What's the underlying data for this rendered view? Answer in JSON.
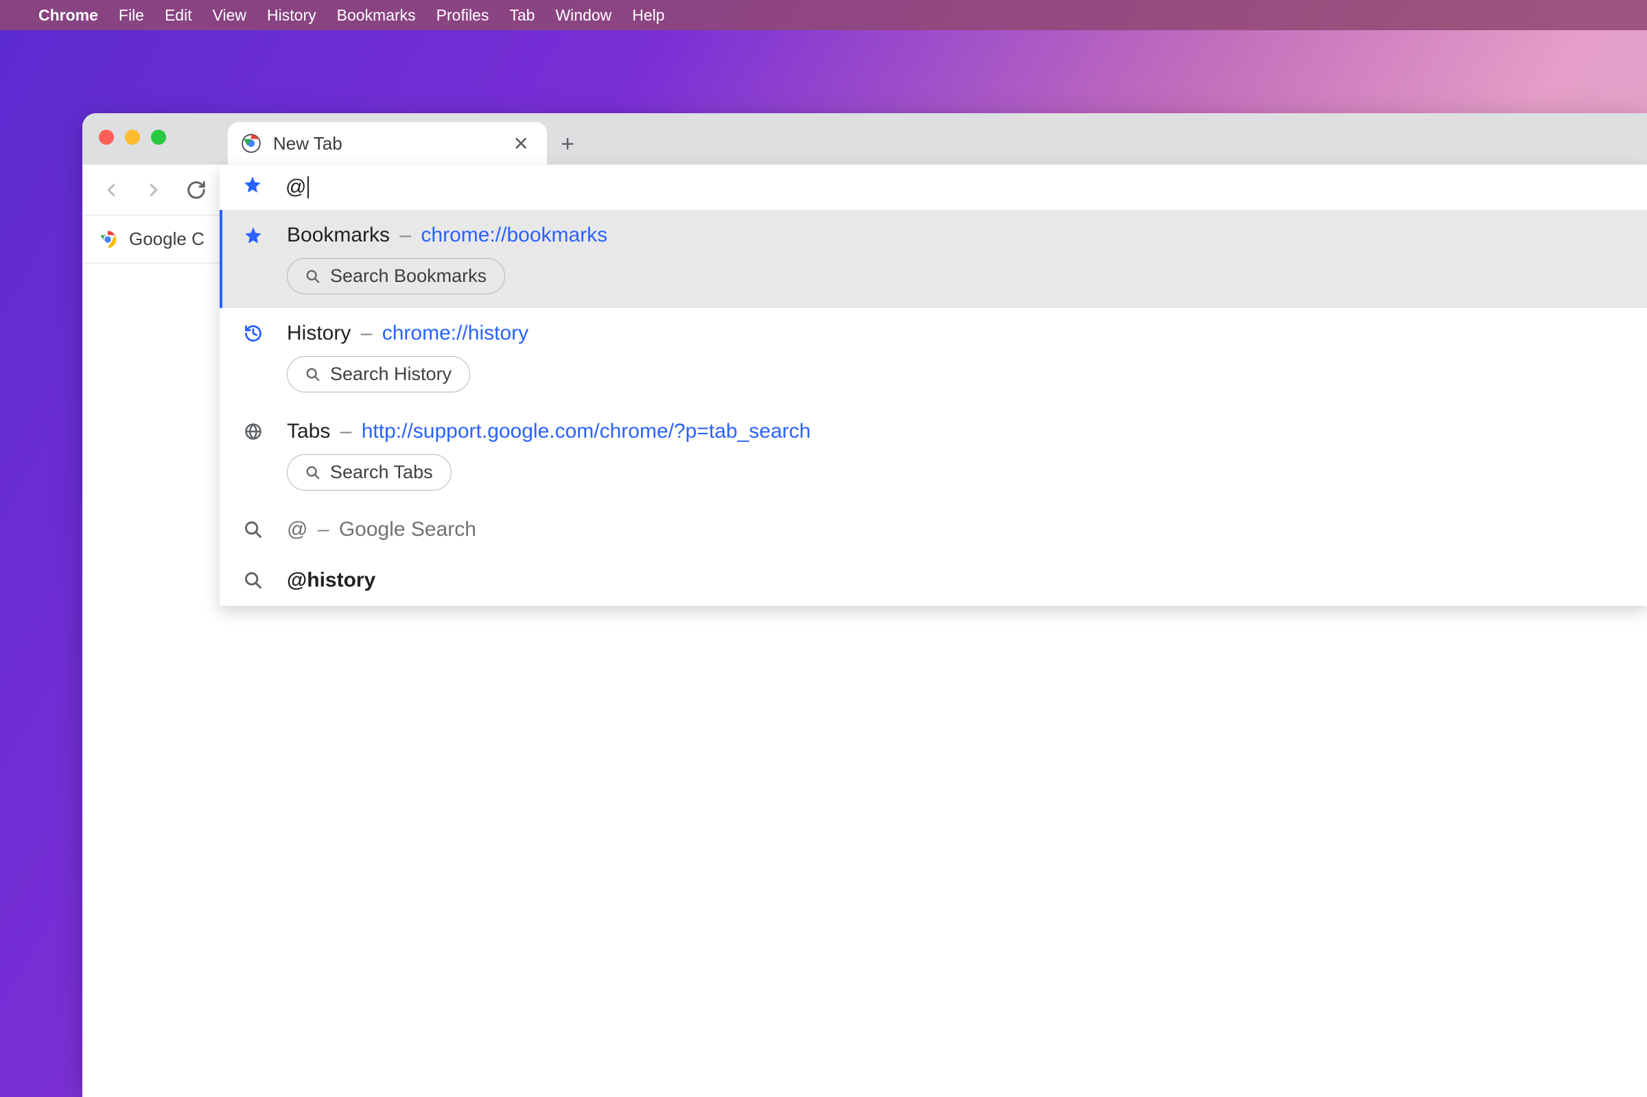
{
  "menubar": {
    "app": "Chrome",
    "items": [
      "File",
      "Edit",
      "View",
      "History",
      "Bookmarks",
      "Profiles",
      "Tab",
      "Window",
      "Help"
    ]
  },
  "window": {
    "tab_title": "New Tab",
    "bookmark_bar_item": "Google C"
  },
  "omnibox": {
    "input": "@",
    "suggestions": [
      {
        "kind": "scoped",
        "icon": "star",
        "title": "Bookmarks",
        "url": "chrome://bookmarks",
        "chip": "Search Bookmarks",
        "selected": true
      },
      {
        "kind": "scoped",
        "icon": "history",
        "title": "History",
        "url": "chrome://history",
        "chip": "Search History",
        "selected": false
      },
      {
        "kind": "scoped",
        "icon": "globe",
        "title": "Tabs",
        "url": "http://support.google.com/chrome/?p=tab_search",
        "chip": "Search Tabs",
        "selected": false
      },
      {
        "kind": "search",
        "icon": "search",
        "title": "@",
        "desc": "Google Search"
      },
      {
        "kind": "search-strong",
        "icon": "search",
        "title": "@history"
      }
    ]
  }
}
